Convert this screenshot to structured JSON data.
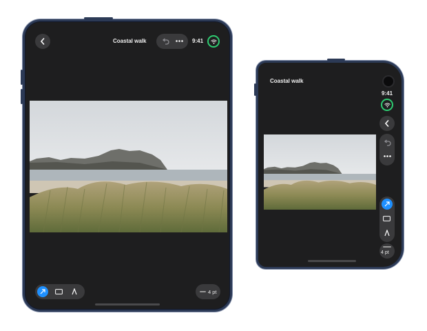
{
  "document": {
    "title": "Coastal walk"
  },
  "status": {
    "time": "9:41"
  },
  "toolbar": {
    "line_width": "4 pt"
  },
  "photo": {
    "subject": "coastal dunes"
  },
  "colors": {
    "accent": "#1e90ff",
    "wifi_ring": "#2ecc71",
    "surface": "#1e1e1f",
    "control": "#3a3a3c"
  }
}
